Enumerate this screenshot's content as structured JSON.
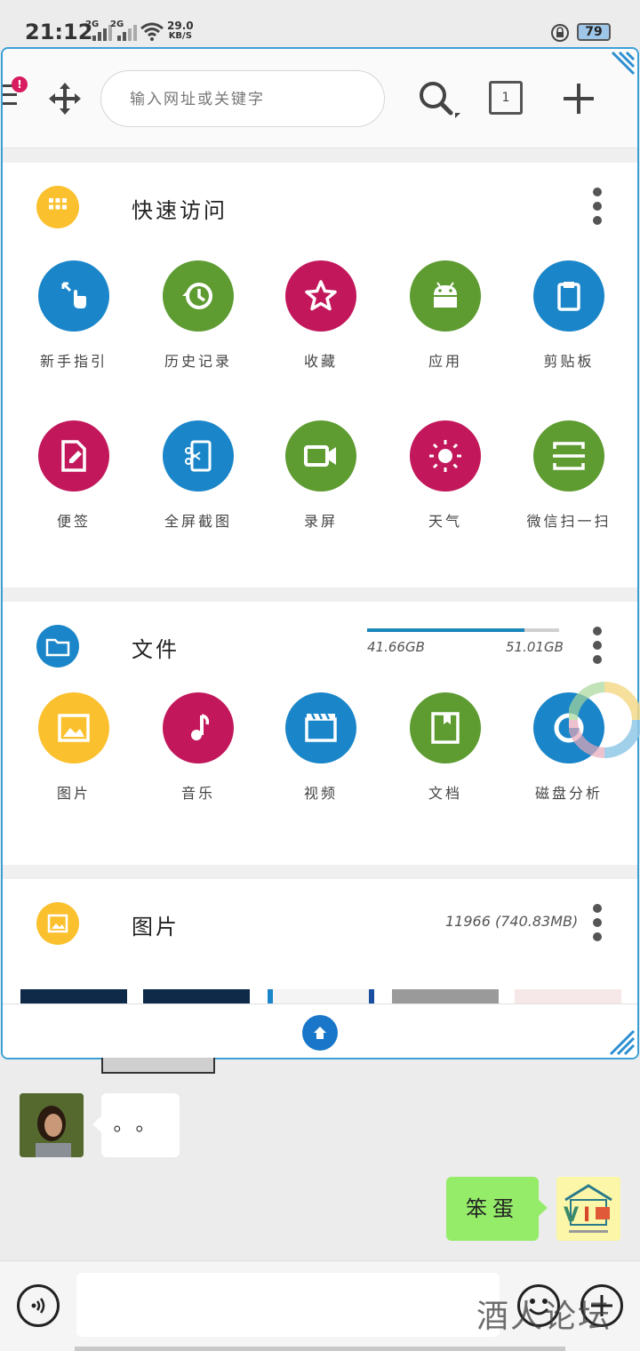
{
  "status_bar": {
    "time": "21:12",
    "signal1_tag": "2G",
    "signal2_tag": "2G",
    "speed_value": "29.0",
    "speed_unit": "KB/S",
    "battery": "79"
  },
  "toolbar": {
    "badge": "!",
    "search_placeholder": "输入网址或关键字",
    "tab_count": "1"
  },
  "quick_access": {
    "title": "快速访问",
    "items": [
      {
        "label": "新手指引",
        "color": "#1a86c9",
        "icon": "touch-guide-icon"
      },
      {
        "label": "历史记录",
        "color": "#5e9b31",
        "icon": "history-icon"
      },
      {
        "label": "收藏",
        "color": "#c2185b",
        "icon": "star-icon"
      },
      {
        "label": "应用",
        "color": "#5e9b31",
        "icon": "android-icon"
      },
      {
        "label": "剪贴板",
        "color": "#1a86c9",
        "icon": "clipboard-icon"
      },
      {
        "label": "便签",
        "color": "#c2185b",
        "icon": "note-icon"
      },
      {
        "label": "全屏截图",
        "color": "#1a86c9",
        "icon": "screenshot-icon"
      },
      {
        "label": "录屏",
        "color": "#5e9b31",
        "icon": "video-record-icon"
      },
      {
        "label": "天气",
        "color": "#c2185b",
        "icon": "sun-icon"
      },
      {
        "label": "微信扫一扫",
        "color": "#5e9b31",
        "icon": "scan-icon"
      }
    ]
  },
  "files": {
    "title": "文件",
    "used": "41.66GB",
    "total": "51.01GB",
    "used_fraction": 0.82,
    "items": [
      {
        "label": "图片",
        "color": "#fbc02d",
        "icon": "image-icon"
      },
      {
        "label": "音乐",
        "color": "#c2185b",
        "icon": "music-icon"
      },
      {
        "label": "视频",
        "color": "#1a86c9",
        "icon": "video-icon"
      },
      {
        "label": "文档",
        "color": "#5e9b31",
        "icon": "document-icon"
      },
      {
        "label": "磁盘分析",
        "color": "#1a86c9",
        "icon": "disk-analysis-icon"
      }
    ]
  },
  "pictures": {
    "title": "图片",
    "count": "11966 (740.83MB)"
  },
  "chat": {
    "left_message": "。。",
    "right_message": "笨蛋",
    "watermark": "酒人论坛"
  }
}
